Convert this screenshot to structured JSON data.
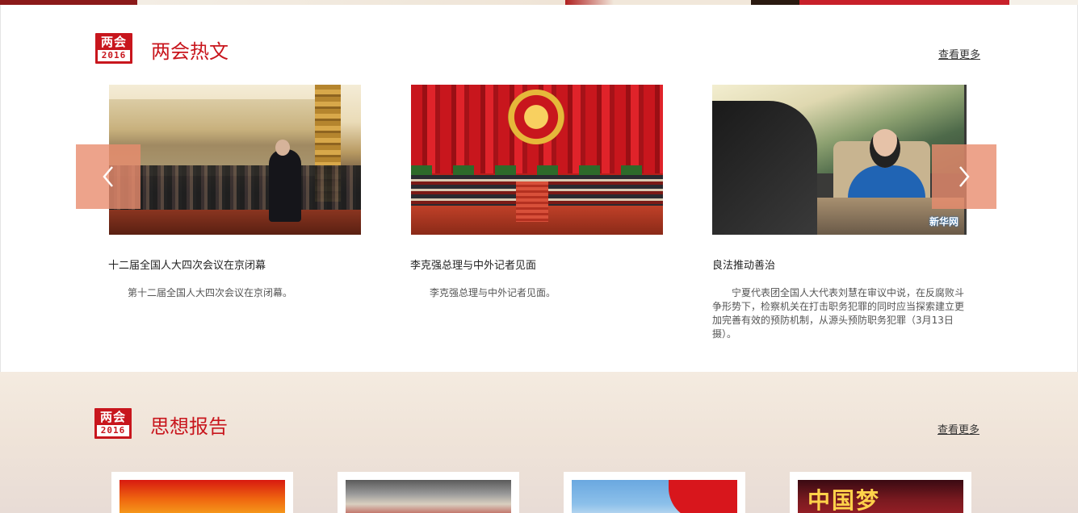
{
  "section1": {
    "badge_top": "两会",
    "badge_year": "2016",
    "title": "两会热文",
    "more": "查看更多",
    "prev_arrow": "‹",
    "next_arrow": "›",
    "cards": [
      {
        "title": "十二届全国人大四次会议在京闭幕",
        "desc": "第十二届全国人大四次会议在京闭幕。"
      },
      {
        "title": "李克强总理与中外记者见面",
        "desc": "李克强总理与中外记者见面。"
      },
      {
        "title": "良法推动善治",
        "desc": "宁夏代表团全国人大代表刘慧在审议中说，在反腐败斗争形势下，检察机关在打击职务犯罪的同时应当探索建立更加完善有效的预防机制，从源头预防职务犯罪（3月13日摄）。",
        "watermark": "新华网"
      }
    ]
  },
  "section2": {
    "badge_top": "两会",
    "badge_year": "2016",
    "title": "思想报告",
    "more": "查看更多",
    "card4_text": "中国梦"
  },
  "colors": {
    "accent": "#c8161d",
    "arrow": "#e88c6e"
  }
}
